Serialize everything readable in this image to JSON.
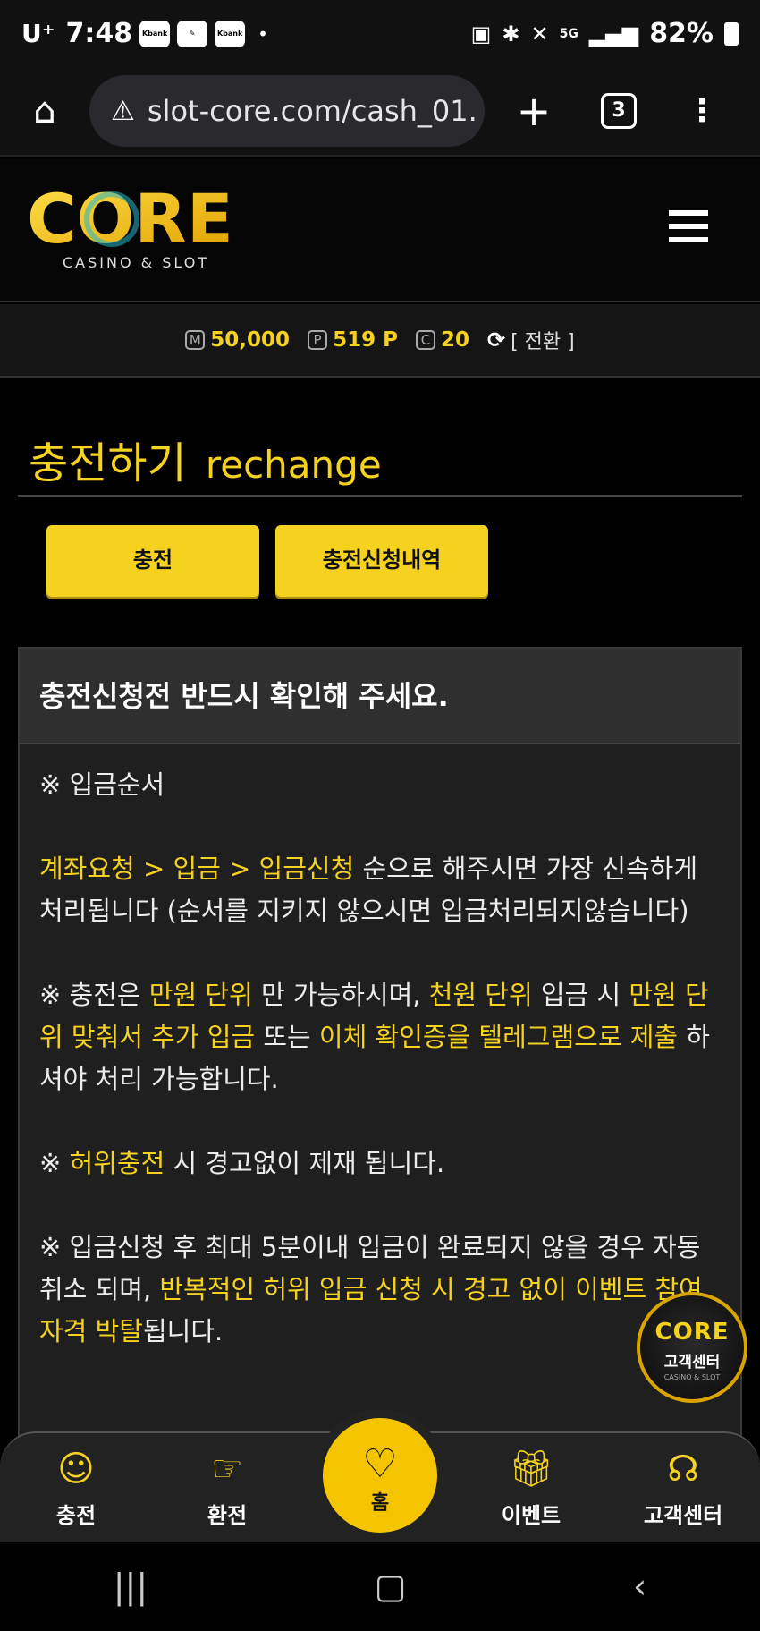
{
  "status_bar": {
    "carrier": "U⁺",
    "time": "7:48",
    "chips": [
      "Kbank",
      "",
      "Kbank"
    ],
    "dot": "•",
    "network": "5G",
    "battery": "82%"
  },
  "browser": {
    "url": "slot-core.com/cash_01.",
    "tab_count": "3"
  },
  "site": {
    "logo_text": "CORE",
    "logo_sub": "CASINO & SLOT"
  },
  "balance": {
    "money_icon": "M",
    "money": "50,000",
    "point_icon": "P",
    "point": "519 P",
    "coin_icon": "C",
    "coin": "20",
    "convert_label": "[ 전환 ]"
  },
  "page": {
    "title_ko": "충전하기",
    "title_en": "rechange",
    "tab_charge": "충전",
    "tab_history": "충전신청내역"
  },
  "notice": {
    "heading": "충전신청전 반드시 확인해 주세요.",
    "p1": "※ 입금순서",
    "p2_yellow": "계좌요청 > 입금 > 입금신청",
    "p2_rest": " 순으로 해주시면 가장 신속하게 처리됩니다 (순서를 지키지 않으시면 입금처리되지않습니다)",
    "p3_a": "※ 충전은 ",
    "p3_b": "만원 단위",
    "p3_c": " 만 가능하시며, ",
    "p3_d": "천원 단위",
    "p3_e": " 입금 시 ",
    "p3_f": "만원 단위 맞춰서 추가 입금",
    "p3_g": " 또는 ",
    "p3_h": "이체 확인증을 텔레그램으로 제출",
    "p3_i": " 하셔야 처리 가능합니다.",
    "p4_a": "※ ",
    "p4_b": "허위충전",
    "p4_c": " 시 경고없이 제재 됩니다.",
    "p5_a": "※ 입금신청 후 최대 5분이내 입금이 완료되지 않을 경우 자동 취소 되며, ",
    "p5_b": "반복적인 허위 입금 신청 시 경고 없이 이벤트 참여 자격 박탈",
    "p5_c": "됩니다."
  },
  "fab": {
    "logo": "CORE",
    "sub": "CASINO & SLOT",
    "label": "고객센터"
  },
  "bottom_nav": {
    "charge": "충전",
    "exchange": "환전",
    "home": "홈",
    "event": "이벤트",
    "support": "고객센터"
  },
  "colors": {
    "accent": "#f5d21f",
    "background": "#000000",
    "panel": "#1f1f1f"
  }
}
